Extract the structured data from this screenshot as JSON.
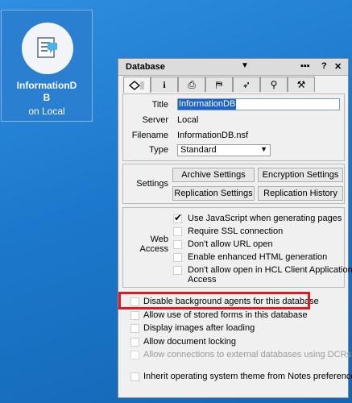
{
  "desktop": {
    "tile": {
      "name": "InformationDB",
      "sub": "on Local",
      "icon": "database-doc-icon"
    }
  },
  "props": {
    "title": "Database",
    "titlebar_icons": [
      "menu-icon",
      "help-icon",
      "close-icon"
    ],
    "tabs": [
      "info-tab",
      "i-tab",
      "printer-tab",
      "design-tab",
      "rocket-tab",
      "search-tab",
      "advanced-tab"
    ],
    "basics": {
      "title_label": "Title",
      "title_value": "InformationDB",
      "server_label": "Server",
      "server_value": "Local",
      "filename_label": "Filename",
      "filename_value": "InformationDB.nsf",
      "type_label": "Type",
      "type_value": "Standard"
    },
    "settings": {
      "label": "Settings",
      "buttons": [
        "Archive Settings",
        "Encryption Settings",
        "Replication Settings",
        "Replication History"
      ]
    },
    "web": {
      "label_line1": "Web",
      "label_line2": "Access",
      "options": [
        {
          "label": "Use JavaScript when generating pages",
          "checked": true
        },
        {
          "label": "Require SSL connection",
          "checked": false
        },
        {
          "label": "Don't allow URL open",
          "checked": false
        },
        {
          "label": "Enable enhanced HTML generation",
          "checked": false
        },
        {
          "label_line1": "Don't allow open in HCL Client Application",
          "label_line2": "Access",
          "checked": false
        }
      ]
    },
    "options": [
      {
        "label": "Disable background agents for this database",
        "checked": false,
        "disabled": false
      },
      {
        "label": "Allow use of stored forms in this database",
        "checked": false,
        "disabled": false
      },
      {
        "label": "Display images after loading",
        "checked": false,
        "disabled": false
      },
      {
        "label": "Allow document locking",
        "checked": false,
        "disabled": false
      },
      {
        "label": "Allow connections to external databases using DCRs",
        "checked": false,
        "disabled": true
      },
      {
        "label": "Inherit operating system theme from Notes preferences",
        "checked": false,
        "disabled": false
      }
    ],
    "highlight_color": "#e01a22"
  }
}
